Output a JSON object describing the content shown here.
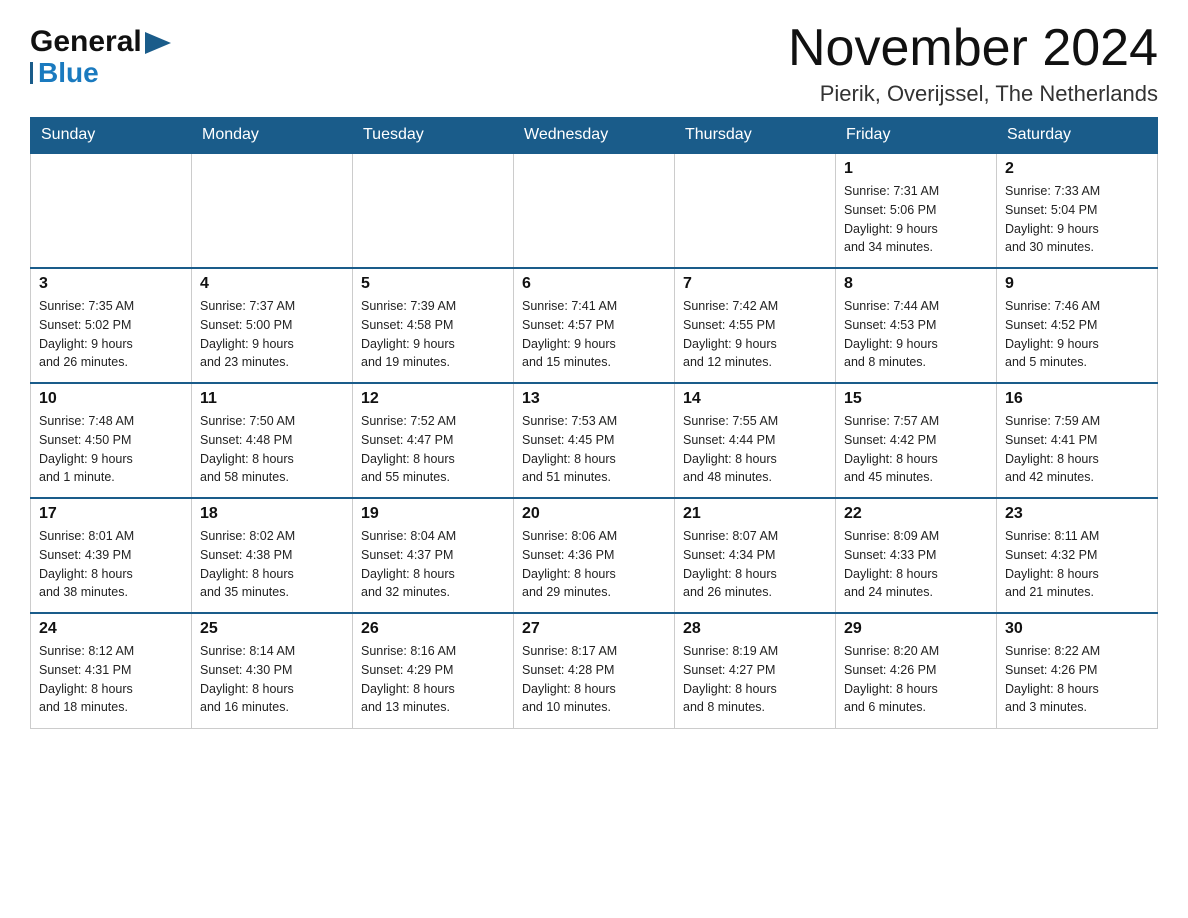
{
  "logo": {
    "general": "General",
    "blue": "Blue",
    "arrow_color": "#1a5c8a"
  },
  "header": {
    "month_year": "November 2024",
    "location": "Pierik, Overijssel, The Netherlands"
  },
  "days_of_week": [
    "Sunday",
    "Monday",
    "Tuesday",
    "Wednesday",
    "Thursday",
    "Friday",
    "Saturday"
  ],
  "weeks": [
    {
      "cells": [
        {
          "day": "",
          "info": ""
        },
        {
          "day": "",
          "info": ""
        },
        {
          "day": "",
          "info": ""
        },
        {
          "day": "",
          "info": ""
        },
        {
          "day": "",
          "info": ""
        },
        {
          "day": "1",
          "info": "Sunrise: 7:31 AM\nSunset: 5:06 PM\nDaylight: 9 hours\nand 34 minutes."
        },
        {
          "day": "2",
          "info": "Sunrise: 7:33 AM\nSunset: 5:04 PM\nDaylight: 9 hours\nand 30 minutes."
        }
      ]
    },
    {
      "cells": [
        {
          "day": "3",
          "info": "Sunrise: 7:35 AM\nSunset: 5:02 PM\nDaylight: 9 hours\nand 26 minutes."
        },
        {
          "day": "4",
          "info": "Sunrise: 7:37 AM\nSunset: 5:00 PM\nDaylight: 9 hours\nand 23 minutes."
        },
        {
          "day": "5",
          "info": "Sunrise: 7:39 AM\nSunset: 4:58 PM\nDaylight: 9 hours\nand 19 minutes."
        },
        {
          "day": "6",
          "info": "Sunrise: 7:41 AM\nSunset: 4:57 PM\nDaylight: 9 hours\nand 15 minutes."
        },
        {
          "day": "7",
          "info": "Sunrise: 7:42 AM\nSunset: 4:55 PM\nDaylight: 9 hours\nand 12 minutes."
        },
        {
          "day": "8",
          "info": "Sunrise: 7:44 AM\nSunset: 4:53 PM\nDaylight: 9 hours\nand 8 minutes."
        },
        {
          "day": "9",
          "info": "Sunrise: 7:46 AM\nSunset: 4:52 PM\nDaylight: 9 hours\nand 5 minutes."
        }
      ]
    },
    {
      "cells": [
        {
          "day": "10",
          "info": "Sunrise: 7:48 AM\nSunset: 4:50 PM\nDaylight: 9 hours\nand 1 minute."
        },
        {
          "day": "11",
          "info": "Sunrise: 7:50 AM\nSunset: 4:48 PM\nDaylight: 8 hours\nand 58 minutes."
        },
        {
          "day": "12",
          "info": "Sunrise: 7:52 AM\nSunset: 4:47 PM\nDaylight: 8 hours\nand 55 minutes."
        },
        {
          "day": "13",
          "info": "Sunrise: 7:53 AM\nSunset: 4:45 PM\nDaylight: 8 hours\nand 51 minutes."
        },
        {
          "day": "14",
          "info": "Sunrise: 7:55 AM\nSunset: 4:44 PM\nDaylight: 8 hours\nand 48 minutes."
        },
        {
          "day": "15",
          "info": "Sunrise: 7:57 AM\nSunset: 4:42 PM\nDaylight: 8 hours\nand 45 minutes."
        },
        {
          "day": "16",
          "info": "Sunrise: 7:59 AM\nSunset: 4:41 PM\nDaylight: 8 hours\nand 42 minutes."
        }
      ]
    },
    {
      "cells": [
        {
          "day": "17",
          "info": "Sunrise: 8:01 AM\nSunset: 4:39 PM\nDaylight: 8 hours\nand 38 minutes."
        },
        {
          "day": "18",
          "info": "Sunrise: 8:02 AM\nSunset: 4:38 PM\nDaylight: 8 hours\nand 35 minutes."
        },
        {
          "day": "19",
          "info": "Sunrise: 8:04 AM\nSunset: 4:37 PM\nDaylight: 8 hours\nand 32 minutes."
        },
        {
          "day": "20",
          "info": "Sunrise: 8:06 AM\nSunset: 4:36 PM\nDaylight: 8 hours\nand 29 minutes."
        },
        {
          "day": "21",
          "info": "Sunrise: 8:07 AM\nSunset: 4:34 PM\nDaylight: 8 hours\nand 26 minutes."
        },
        {
          "day": "22",
          "info": "Sunrise: 8:09 AM\nSunset: 4:33 PM\nDaylight: 8 hours\nand 24 minutes."
        },
        {
          "day": "23",
          "info": "Sunrise: 8:11 AM\nSunset: 4:32 PM\nDaylight: 8 hours\nand 21 minutes."
        }
      ]
    },
    {
      "cells": [
        {
          "day": "24",
          "info": "Sunrise: 8:12 AM\nSunset: 4:31 PM\nDaylight: 8 hours\nand 18 minutes."
        },
        {
          "day": "25",
          "info": "Sunrise: 8:14 AM\nSunset: 4:30 PM\nDaylight: 8 hours\nand 16 minutes."
        },
        {
          "day": "26",
          "info": "Sunrise: 8:16 AM\nSunset: 4:29 PM\nDaylight: 8 hours\nand 13 minutes."
        },
        {
          "day": "27",
          "info": "Sunrise: 8:17 AM\nSunset: 4:28 PM\nDaylight: 8 hours\nand 10 minutes."
        },
        {
          "day": "28",
          "info": "Sunrise: 8:19 AM\nSunset: 4:27 PM\nDaylight: 8 hours\nand 8 minutes."
        },
        {
          "day": "29",
          "info": "Sunrise: 8:20 AM\nSunset: 4:26 PM\nDaylight: 8 hours\nand 6 minutes."
        },
        {
          "day": "30",
          "info": "Sunrise: 8:22 AM\nSunset: 4:26 PM\nDaylight: 8 hours\nand 3 minutes."
        }
      ]
    }
  ]
}
